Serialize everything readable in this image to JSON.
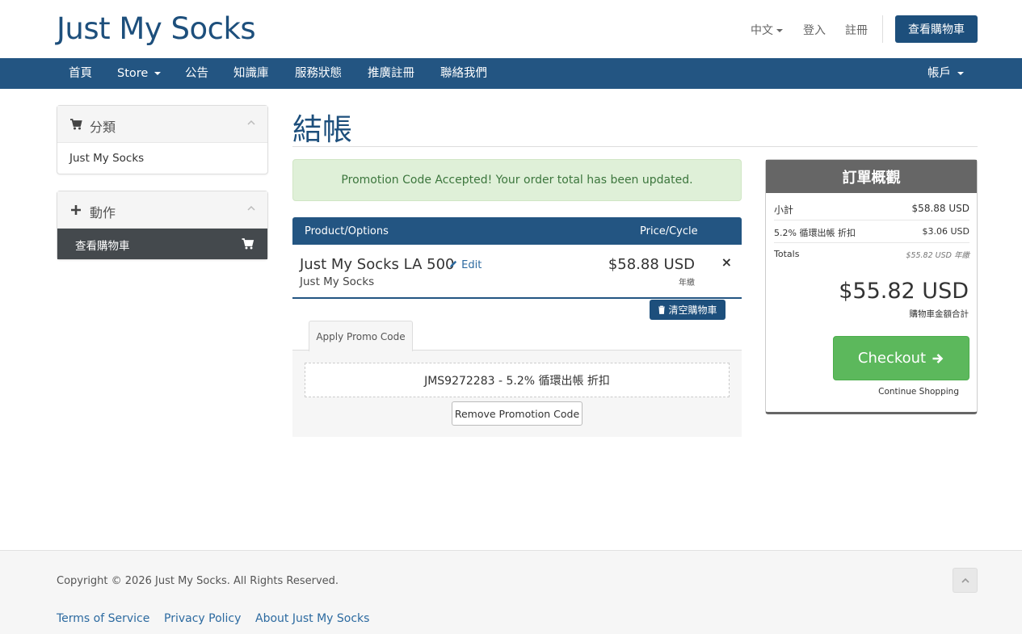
{
  "header": {
    "logo": "Just My Socks",
    "lang": "中文",
    "login": "登入",
    "register": "註冊",
    "view_cart": "查看購物車"
  },
  "nav": {
    "items": [
      "首頁",
      "Store",
      "公告",
      "知識庫",
      "服務狀態",
      "推廣註冊",
      "聯絡我們"
    ],
    "account": "帳戶"
  },
  "sidebar": {
    "categories": {
      "title": "分類",
      "items": [
        "Just My Socks"
      ]
    },
    "actions": {
      "title": "動作",
      "active_item": "查看購物車"
    }
  },
  "main": {
    "title": "結帳",
    "alert": "Promotion Code Accepted! Your order total has been updated.",
    "table": {
      "col_product": "Product/Options",
      "col_price": "Price/Cycle",
      "row": {
        "name": "Just My Socks LA 500",
        "edit": "Edit",
        "group": "Just My Socks",
        "price": "$58.88 USD",
        "cycle": "年繳",
        "remove": "×"
      }
    },
    "empty_cart": "清空購物車",
    "promo": {
      "tab": "Apply Promo Code",
      "code": "JMS9272283 - 5.2% 循環出帳 折扣",
      "remove": "Remove Promotion Code"
    }
  },
  "summary": {
    "title": "訂單概觀",
    "subtotal_label": "小計",
    "subtotal_value": "$58.88 USD",
    "discount_label": "5.2% 循環出帳 折扣",
    "discount_value": "$3.06 USD",
    "totals_label": "Totals",
    "totals_value": "$55.82 USD 年繳",
    "total": "$55.82 USD",
    "total_label": "購物車金額合計",
    "checkout": "Checkout",
    "continue": "Continue Shopping"
  },
  "footer": {
    "copyright": "Copyright © 2026 Just My Socks. All Rights Reserved.",
    "links": [
      "Terms of Service",
      "Privacy Policy",
      "About Just My Socks"
    ]
  },
  "colors": {
    "brand": "#1d4f7c",
    "nav": "#235582",
    "success": "#5cb85c",
    "summary_head": "#666666"
  }
}
